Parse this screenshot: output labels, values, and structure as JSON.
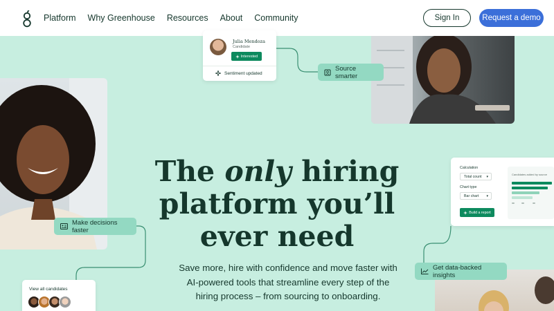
{
  "nav": {
    "links": [
      "Platform",
      "Why Greenhouse",
      "Resources",
      "About",
      "Community"
    ],
    "signin_label": "Sign In",
    "demo_label": "Request a demo"
  },
  "hero": {
    "title_line1_pre": "The ",
    "title_line1_em": "only",
    "title_line1_post": " hiring",
    "title_line2": "platform you’ll",
    "title_line3": "ever need",
    "subtitle": "Save more, hire with confidence and move faster with AI-powered tools that streamline every step of the hiring process – from sourcing to onboarding."
  },
  "candidate_card": {
    "name": "Julia Mendoza",
    "role": "Candidate",
    "tag": "Interested",
    "status": "Sentiment updated"
  },
  "pills": {
    "source": "Source smarter",
    "decisions": "Make decisions faster",
    "insights": "Get data-backed insights"
  },
  "report_card": {
    "calculation_label": "Calculation",
    "calculation_value": "Total count",
    "chart_type_label": "Chart type",
    "chart_type_value": "Bar chart",
    "build_button": "Build a report",
    "chart_title": "Candidates added by source"
  },
  "candidates_card": {
    "label": "View all candidates"
  },
  "colors": {
    "background": "#c7eee0",
    "accent_green": "#0d8a5e",
    "pill": "#93d9c2",
    "demo_blue": "#3b6fd9",
    "text_dark": "#15372c"
  }
}
